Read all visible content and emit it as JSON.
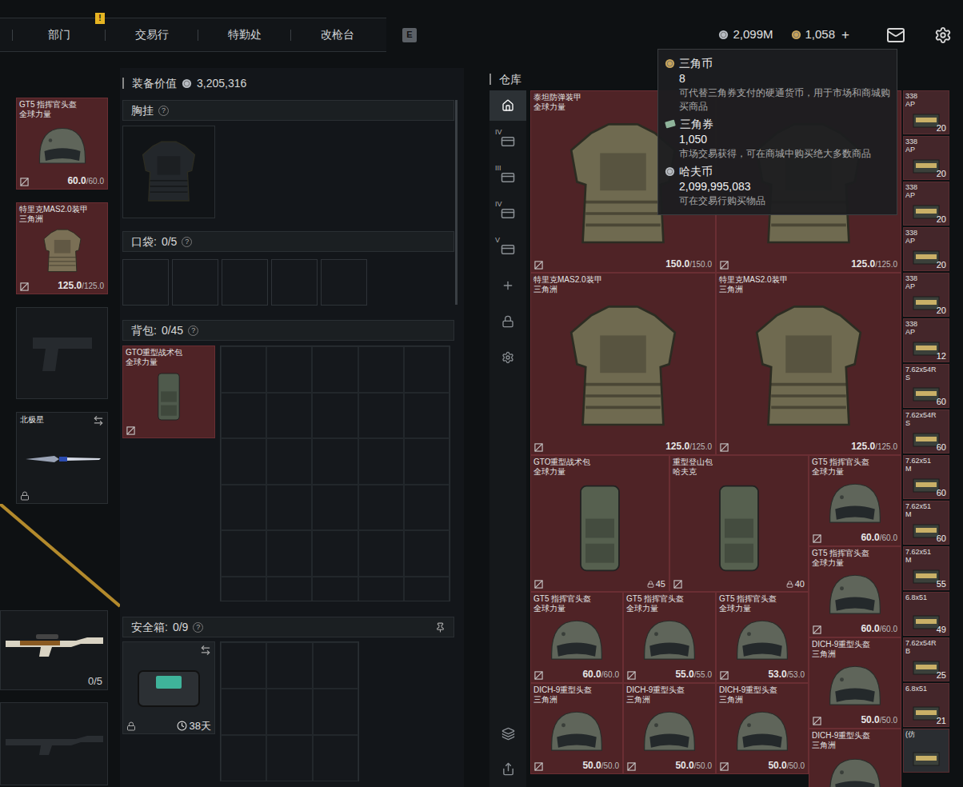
{
  "top_bar": {
    "tabs": [
      {
        "label": "部门",
        "selected": false
      },
      {
        "label": "交易行",
        "selected": false
      },
      {
        "label": "特勤处",
        "selected": false
      },
      {
        "label": "改枪台",
        "selected": false
      }
    ],
    "alert_badge": "!",
    "hotkey": "E",
    "currencies": [
      {
        "kind": "haf",
        "value": "2,099M"
      },
      {
        "kind": "coin",
        "value": "1,058"
      }
    ],
    "add": "+"
  },
  "loadout": [
    {
      "kind": "helmet",
      "name": "GT5 指挥官头盔",
      "origin": "全球力量",
      "current": "60.0",
      "max": "/60.0",
      "color": "#4f2326"
    },
    {
      "kind": "armor",
      "name": "特里克MAS2.0装甲",
      "origin": "三角洲",
      "current": "125.0",
      "max": "/125.0",
      "color": "#4f2326"
    },
    {
      "kind": "pistol",
      "empty": true,
      "color": "#16191c"
    },
    {
      "kind": "knife",
      "name": "北极星",
      "locked": true,
      "swappable": true,
      "color": "#16191c"
    },
    {
      "kind": "rifle",
      "empty": false,
      "ammo": "0/5",
      "color": "#16191c"
    },
    {
      "kind": "rifle",
      "empty": true,
      "ammo": "",
      "color": "#16191c"
    }
  ],
  "equipment": {
    "value_label": "装备价值",
    "value": "3,205,316",
    "chest_rig": {
      "title": "胸挂",
      "help": "?",
      "empty": true
    },
    "pockets": {
      "title": "口袋:",
      "count": "0/5",
      "help": "?"
    },
    "backpack": {
      "title": "背包:",
      "count": "0/45",
      "help": "?",
      "item": {
        "name": "GTO重型战术包",
        "origin": "全球力量",
        "color": "#4f2326"
      }
    },
    "safe": {
      "title": "安全箱:",
      "count": "0/9",
      "help": "?",
      "days": "38天",
      "locked": true,
      "swappable": true,
      "pinned": true
    }
  },
  "warehouse": {
    "title": "仓库",
    "tabs": [
      {
        "icon": "home",
        "label": "",
        "selected": true
      },
      {
        "icon": "card",
        "label": "IV",
        "selected": false
      },
      {
        "icon": "card",
        "label": "III",
        "selected": false
      },
      {
        "icon": "card",
        "label": "IV",
        "selected": false
      },
      {
        "icon": "card",
        "label": "V",
        "selected": false
      },
      {
        "icon": "plus",
        "label": "",
        "selected": false
      },
      {
        "icon": "lock",
        "label": "",
        "selected": false
      },
      {
        "icon": "gear",
        "label": "",
        "selected": false
      }
    ],
    "tools": [
      {
        "icon": "layers"
      },
      {
        "icon": "export"
      }
    ],
    "items": [
      {
        "kind": "armor",
        "name": "泰坦防弹装甲",
        "origin": "全球力量",
        "current": "150.0",
        "max": "/150.0",
        "color": "#4f2326"
      },
      {
        "kind": "armor",
        "name": "",
        "origin": "",
        "current": "125.0",
        "max": "/125.0",
        "color": "#4f2326"
      },
      {
        "kind": "armor",
        "name": "特里克MAS2.0装甲",
        "origin": "三角洲",
        "current": "125.0",
        "max": "/125.0",
        "color": "#4f2326"
      },
      {
        "kind": "armor",
        "name": "特里克MAS2.0装甲",
        "origin": "三角洲",
        "current": "125.0",
        "max": "/125.0",
        "color": "#4f2326"
      },
      {
        "kind": "backpack",
        "name": "GTO重型战术包",
        "origin": "全球力量",
        "capacity": "45",
        "color": "#4f2326"
      },
      {
        "kind": "backpack",
        "name": "重型登山包",
        "origin": "哈夫克",
        "capacity": "40",
        "color": "#4f2326"
      },
      {
        "kind": "helmet",
        "name": "GT5 指挥官头盔",
        "origin": "全球力量",
        "current": "60.0",
        "max": "/60.0",
        "color": "#4f2326"
      },
      {
        "kind": "helmet",
        "name": "GT5 指挥官头盔",
        "origin": "全球力量",
        "current": "60.0",
        "max": "/60.0",
        "color": "#4f2326"
      },
      {
        "kind": "helmet",
        "name": "GT5 指挥官头盔",
        "origin": "全球力量",
        "current": "60.0",
        "max": "/60.0",
        "color": "#4f2326"
      },
      {
        "kind": "helmet",
        "name": "GT5 指挥官头盔",
        "origin": "全球力量",
        "current": "55.0",
        "max": "/55.0",
        "color": "#4f2326"
      },
      {
        "kind": "helmet",
        "name": "GT5 指挥官头盔",
        "origin": "全球力量",
        "current": "53.0",
        "max": "/53.0",
        "color": "#4f2326"
      },
      {
        "kind": "helmet",
        "name": "DICH-9重型头盔",
        "origin": "三角洲",
        "current": "50.0",
        "max": "/50.0",
        "color": "#4f2326"
      },
      {
        "kind": "helmet",
        "name": "DICH-9重型头盔",
        "origin": "三角洲",
        "current": "50.0",
        "max": "/50.0",
        "color": "#4f2326"
      },
      {
        "kind": "helmet",
        "name": "DICH-9重型头盔",
        "origin": "三角洲",
        "current": "50.0",
        "max": "/50.0",
        "color": "#4f2326"
      },
      {
        "kind": "helmet",
        "name": "DICH-9重型头盔",
        "origin": "三角洲",
        "current": "50.0",
        "max": "/50.0",
        "color": "#4f2326"
      },
      {
        "kind": "helmet",
        "name": "DICH-9重型头盔",
        "origin": "三角洲",
        "current": "",
        "max": "",
        "color": "#4f2326"
      }
    ],
    "ammo": [
      {
        "name": "338",
        "sub": "AP",
        "count": "20",
        "color": "#44262a"
      },
      {
        "name": "338",
        "sub": "AP",
        "count": "20",
        "color": "#44262a"
      },
      {
        "name": "338",
        "sub": "AP",
        "count": "20",
        "color": "#44262a"
      },
      {
        "name": "338",
        "sub": "AP",
        "count": "20",
        "color": "#44262a"
      },
      {
        "name": "338",
        "sub": "AP",
        "count": "20",
        "color": "#44262a"
      },
      {
        "name": "338",
        "sub": "AP",
        "count": "12",
        "color": "#44262a"
      },
      {
        "name": "7.62x54R",
        "sub": "S",
        "count": "60",
        "color": "#44262a"
      },
      {
        "name": "7.62x54R",
        "sub": "S",
        "count": "60",
        "color": "#44262a"
      },
      {
        "name": "7.62x51",
        "sub": "M",
        "count": "60",
        "color": "#44262a"
      },
      {
        "name": "7.62x51",
        "sub": "M",
        "count": "60",
        "color": "#44262a"
      },
      {
        "name": "7.62x51",
        "sub": "M",
        "count": "55",
        "color": "#44262a"
      },
      {
        "name": "6.8x51",
        "sub": "",
        "count": "49",
        "color": "#44262a"
      },
      {
        "name": "7.62x54R",
        "sub": "B",
        "count": "25",
        "color": "#44262a"
      },
      {
        "name": "6.8x51",
        "sub": "",
        "count": "21",
        "color": "#44262a"
      },
      {
        "name": "(仿",
        "sub": "",
        "count": "",
        "color": "#2a2d31"
      }
    ]
  },
  "tooltip": {
    "items": [
      {
        "kind": "coin",
        "name": "三角币",
        "value": "8",
        "desc": "可代替三角券支付的硬通货币，用于市场和商城购买商品"
      },
      {
        "kind": "ticket",
        "name": "三角券",
        "value": "1,050",
        "desc": "市场交易获得，可在商城中购买绝大多数商品"
      },
      {
        "kind": "haf",
        "name": "哈夫币",
        "value": "2,099,995,083",
        "desc": "可在交易行购买物品"
      }
    ]
  }
}
